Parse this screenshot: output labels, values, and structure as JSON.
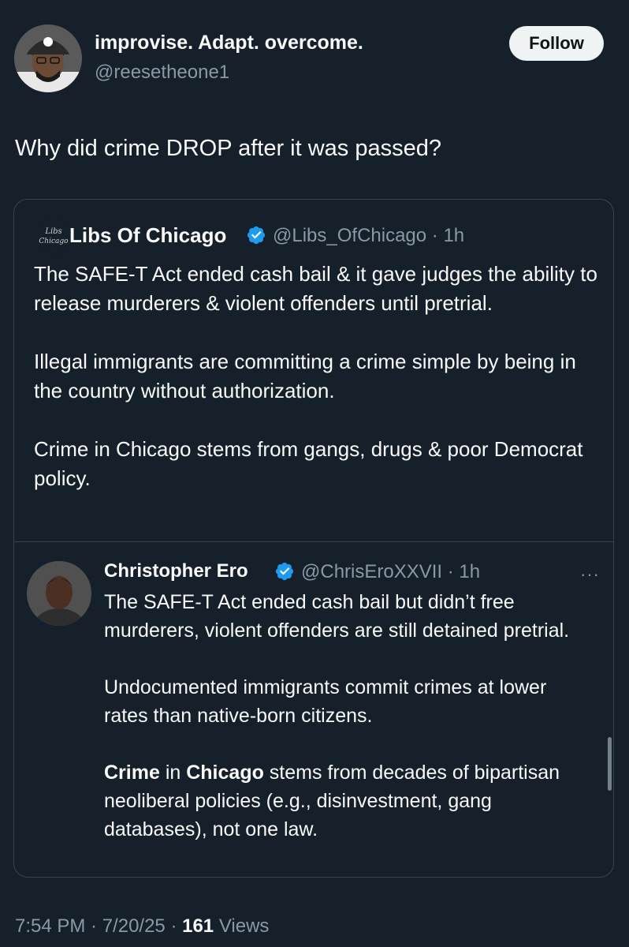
{
  "author": {
    "display_name": "improvise. Adapt. overcome.",
    "handle": "@reesetheone1",
    "follow_label": "Follow"
  },
  "tweet": {
    "text": "Why did crime DROP after it was passed?"
  },
  "quoted": {
    "display_name": "Libs Of Chicago",
    "handle_time": "@Libs_OfChicago · 1h",
    "avatar_text": "Libs Of Chicago",
    "paragraphs": [
      "The SAFE-T Act ended cash bail & it gave judges the ability to release murderers & violent offenders until pretrial.",
      "Illegal immigrants are committing a crime simple by being in the country without authorization.",
      "Crime in Chicago stems from gangs, drugs & poor Democrat policy."
    ]
  },
  "reply": {
    "display_name": "Christopher Ero",
    "handle_time": "@ChrisEroXXVII · 1h",
    "more": "···",
    "para1": "The SAFE-T Act ended cash bail but didn’t free murderers, violent offenders are still detained pretrial.",
    "para2": "Undocumented immigrants commit crimes at lower rates than native-born citizens.",
    "para3": {
      "w1": "Crime",
      "t1": " in ",
      "w2": "Chicago",
      "t2": " stems from decades of bipartisan neoliberal policies (e.g., disinvestment, gang databases), not one law."
    }
  },
  "footer": {
    "timestamp": "7:54 PM · 7/20/25 · ",
    "views_count": "161",
    "views_label": " Views"
  },
  "colors": {
    "background": "#15202b",
    "text": "#f7f9f9",
    "muted": "#8b98a5",
    "border": "#38444d",
    "verified": "#1d9bf0"
  }
}
